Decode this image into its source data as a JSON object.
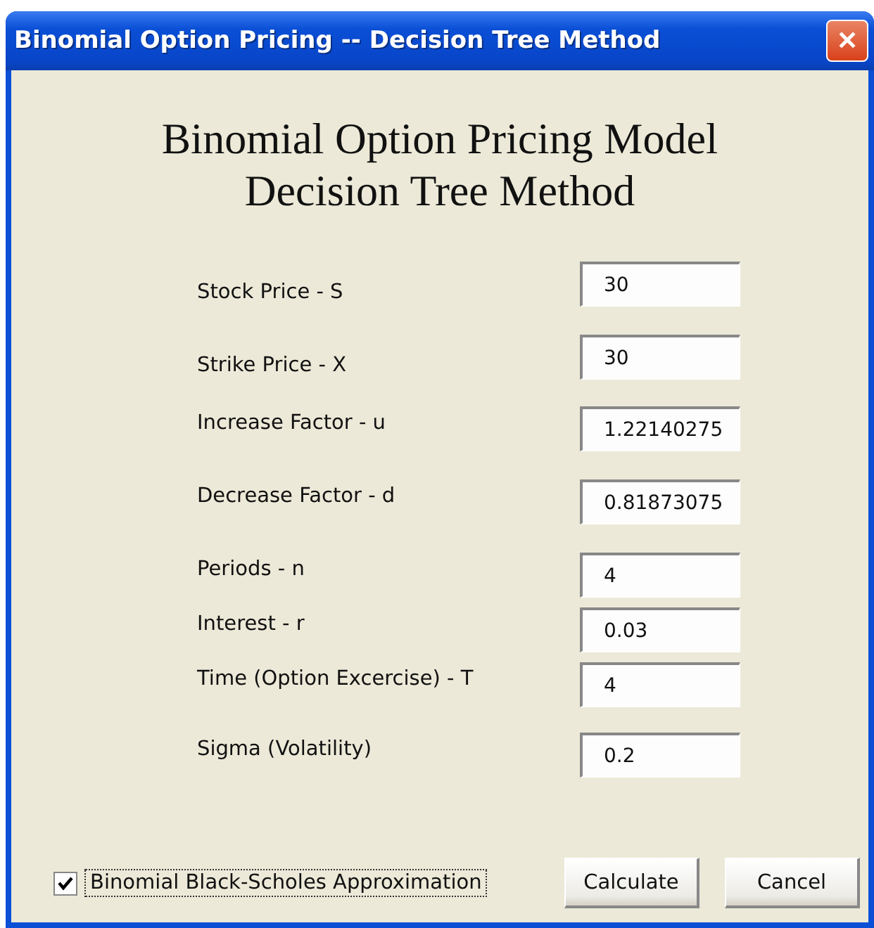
{
  "window": {
    "title": "Binomial Option Pricing -- Decision Tree Method",
    "close": "✕"
  },
  "heading": [
    "Binomial Option Pricing Model",
    "Decision Tree Method"
  ],
  "fields": [
    {
      "label": "Stock Price - S",
      "value": "30"
    },
    {
      "label": "Strike Price - X",
      "value": "30"
    },
    {
      "label": "Increase Factor - u",
      "value": "1.22140275"
    },
    {
      "label": "Decrease Factor - d",
      "value": "0.81873075"
    },
    {
      "label": "Periods - n",
      "value": "4"
    },
    {
      "label": "Interest - r",
      "value": "0.03"
    },
    {
      "label": "Time (Option Excercise) - T",
      "value": "4"
    },
    {
      "label": "Sigma (Volatility)",
      "value": "0.2"
    }
  ],
  "checkbox": {
    "label": "Binomial Black-Scholes Approximation",
    "checked": true
  },
  "buttons": [
    "Calculate",
    "Cancel"
  ]
}
